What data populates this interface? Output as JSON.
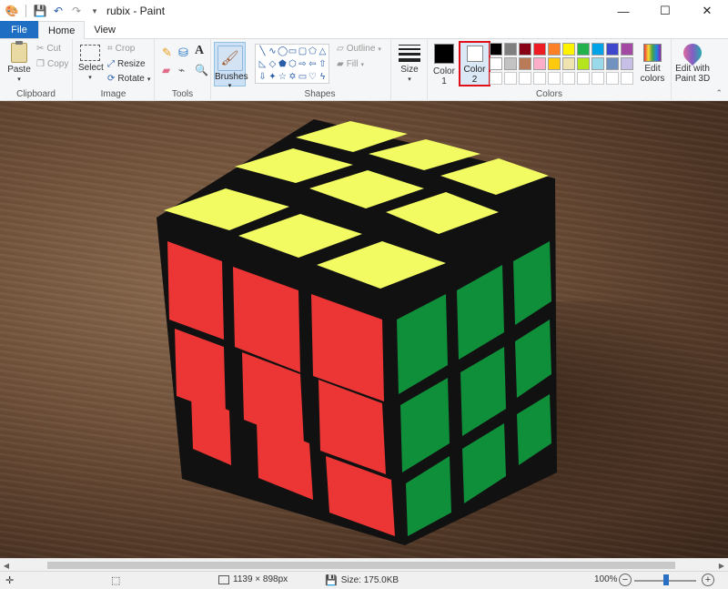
{
  "window": {
    "title": "rubix - Paint",
    "controls": {
      "minimize": "—",
      "maximize": "☐",
      "close": "✕"
    }
  },
  "quick_access": [
    {
      "icon": "save-icon",
      "glyph": "💾"
    },
    {
      "icon": "undo-icon",
      "glyph": "↶"
    },
    {
      "icon": "redo-icon",
      "glyph": "↷"
    },
    {
      "icon": "customize-icon",
      "glyph": "▾"
    }
  ],
  "tabs": {
    "file": "File",
    "home": "Home",
    "view": "View"
  },
  "ribbon": {
    "clipboard": {
      "label": "Clipboard",
      "paste": "Paste",
      "cut": "Cut",
      "copy": "Copy"
    },
    "image": {
      "label": "Image",
      "select": "Select",
      "crop": "Crop",
      "resize": "Resize",
      "rotate": "Rotate"
    },
    "tools": {
      "label": "Tools"
    },
    "brushes": {
      "label": "Brushes"
    },
    "shapes": {
      "label": "Shapes",
      "outline": "Outline",
      "fill": "Fill"
    },
    "size": {
      "label": "Size"
    },
    "colors": {
      "label": "Colors",
      "color1_line1": "Color",
      "color1_line2": "1",
      "color2_line1": "Color",
      "color2_line2": "2",
      "edit_line1": "Edit",
      "edit_line2": "colors",
      "p3d_line1": "Edit with",
      "p3d_line2": "Paint 3D",
      "color1": "#000000",
      "color2": "#ffffff",
      "palette": [
        "#000000",
        "#7f7f7f",
        "#880015",
        "#ed1c24",
        "#ff7f27",
        "#fff200",
        "#22b14c",
        "#00a2e8",
        "#3f48cc",
        "#a349a4",
        "#ffffff",
        "#c3c3c3",
        "#b97a57",
        "#ffaec9",
        "#ffc90e",
        "#efe4b0",
        "#b5e61d",
        "#99d9ea",
        "#7092be",
        "#c8bfe7",
        "#ffffff",
        "#ffffff",
        "#ffffff",
        "#ffffff",
        "#ffffff",
        "#ffffff",
        "#ffffff",
        "#ffffff",
        "#ffffff",
        "#ffffff"
      ]
    }
  },
  "status": {
    "dimensions": "1139 × 898px",
    "size": "Size: 175.0KB",
    "zoom": "100%",
    "zoom_out": "−",
    "zoom_in": "+"
  },
  "cube_colors": {
    "top": "#f3fb63",
    "left": "#ec3535",
    "right": "#0f8f3a",
    "body": "#111111"
  }
}
